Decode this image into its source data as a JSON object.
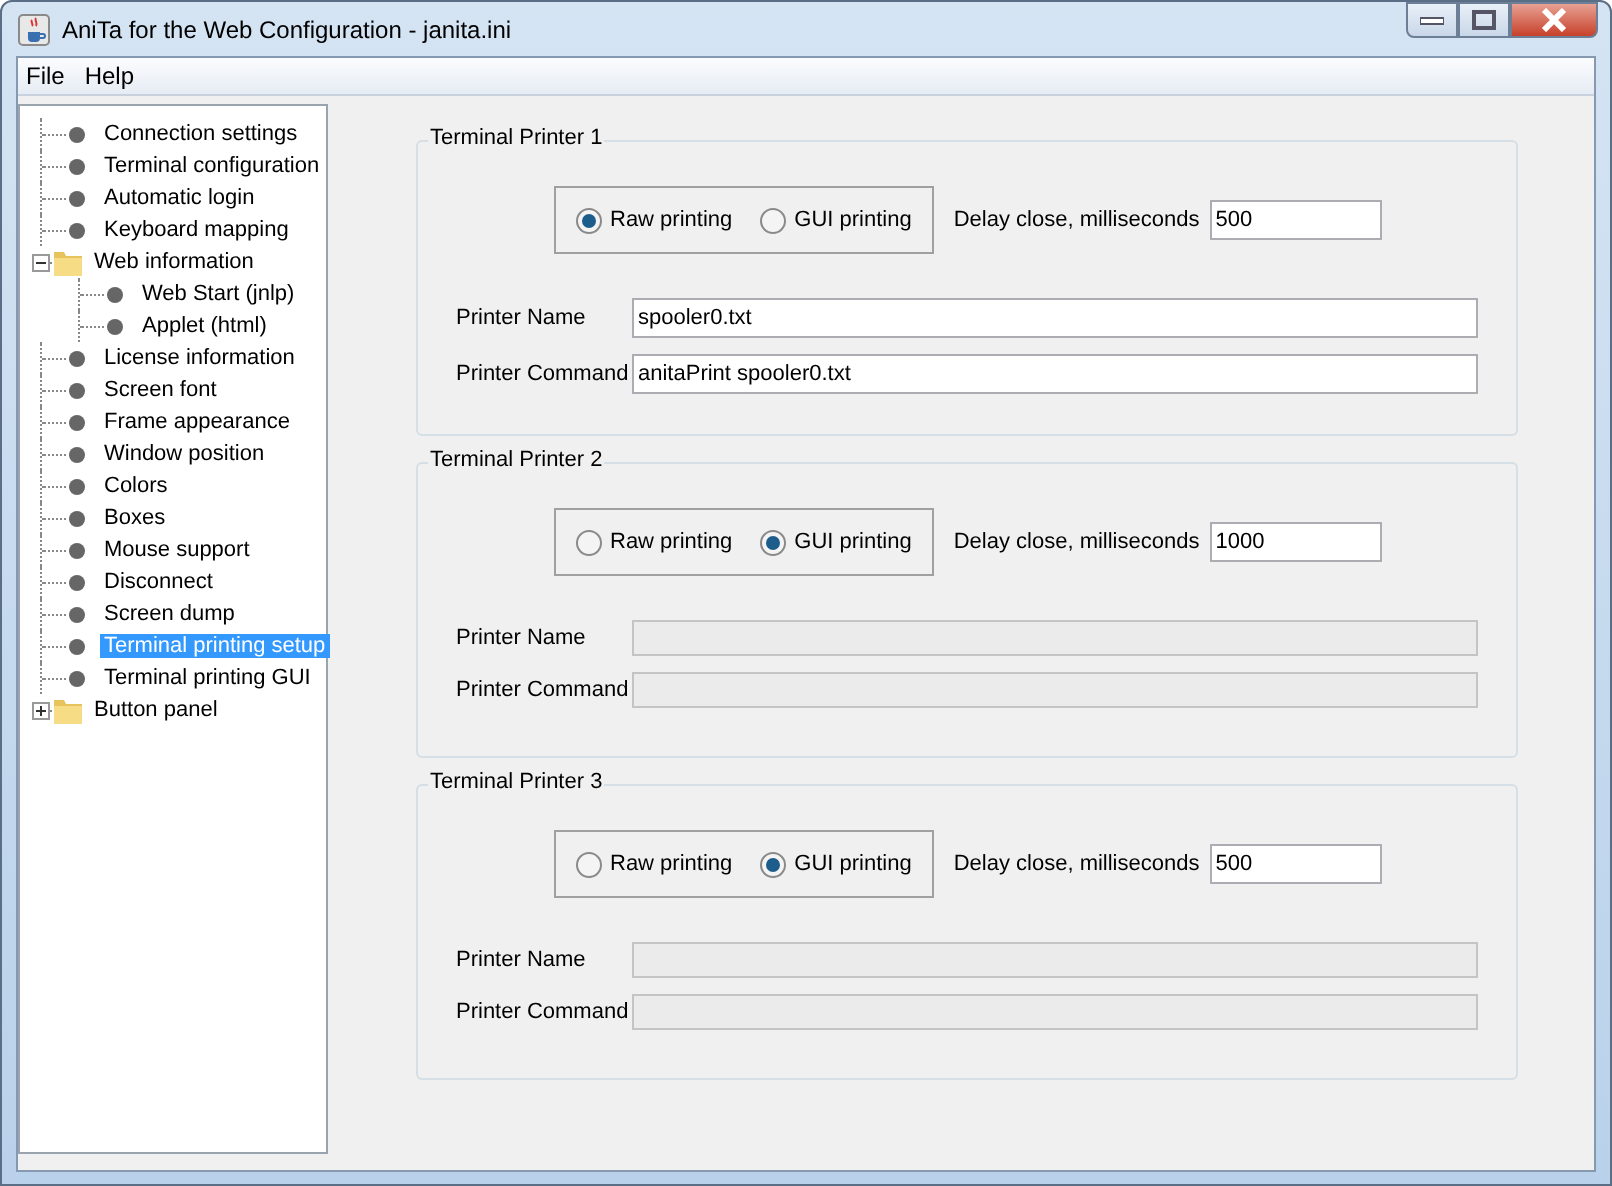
{
  "window": {
    "title": "AniTa for the Web Configuration - janita.ini"
  },
  "menu": [
    "File",
    "Help"
  ],
  "tree": [
    {
      "label": "Connection settings",
      "kind": "leaf",
      "selected": false
    },
    {
      "label": "Terminal configuration",
      "kind": "leaf",
      "selected": false
    },
    {
      "label": "Automatic login",
      "kind": "leaf",
      "selected": false
    },
    {
      "label": "Keyboard mapping",
      "kind": "leaf",
      "selected": false
    },
    {
      "label": "Web information",
      "kind": "folder",
      "selected": false,
      "expanded": true,
      "children": [
        {
          "label": "Web Start (jnlp)",
          "kind": "leaf",
          "selected": false
        },
        {
          "label": "Applet (html)",
          "kind": "leaf",
          "selected": false
        }
      ]
    },
    {
      "label": "License information",
      "kind": "leaf",
      "selected": false
    },
    {
      "label": "Screen font",
      "kind": "leaf",
      "selected": false
    },
    {
      "label": "Frame appearance",
      "kind": "leaf",
      "selected": false
    },
    {
      "label": "Window position",
      "kind": "leaf",
      "selected": false
    },
    {
      "label": "Colors",
      "kind": "leaf",
      "selected": false
    },
    {
      "label": "Boxes",
      "kind": "leaf",
      "selected": false
    },
    {
      "label": "Mouse support",
      "kind": "leaf",
      "selected": false
    },
    {
      "label": "Disconnect",
      "kind": "leaf",
      "selected": false
    },
    {
      "label": "Screen dump",
      "kind": "leaf",
      "selected": false
    },
    {
      "label": "Terminal printing setup",
      "kind": "leaf",
      "selected": true
    },
    {
      "label": "Terminal printing GUI",
      "kind": "leaf",
      "selected": false
    },
    {
      "label": "Button panel",
      "kind": "folder",
      "selected": false,
      "expanded": false
    }
  ],
  "printers": [
    {
      "title": "Terminal Printer 1",
      "modes": [
        {
          "label": "Raw printing",
          "selected": true
        },
        {
          "label": "GUI printing",
          "selected": false
        }
      ],
      "delay_label": "Delay close, milliseconds",
      "delay": "500",
      "name_label": "Printer Name",
      "name": {
        "value": "spooler0.txt",
        "disabled": false
      },
      "command_label": "Printer Command",
      "command": {
        "value": "anitaPrint spooler0.txt",
        "disabled": false
      }
    },
    {
      "title": "Terminal Printer 2",
      "modes": [
        {
          "label": "Raw printing",
          "selected": false
        },
        {
          "label": "GUI printing",
          "selected": true
        }
      ],
      "delay_label": "Delay close, milliseconds",
      "delay": "1000",
      "name_label": "Printer Name",
      "name": {
        "disabled": true
      },
      "command_label": "Printer Command",
      "command": {
        "disabled": true
      }
    },
    {
      "title": "Terminal Printer 3",
      "modes": [
        {
          "label": "Raw printing",
          "selected": false
        },
        {
          "label": "GUI printing",
          "selected": true
        }
      ],
      "delay_label": "Delay close, milliseconds",
      "delay": "500",
      "name_label": "Printer Name",
      "name": {
        "disabled": true
      },
      "command_label": "Printer Command",
      "command": {
        "disabled": true
      }
    }
  ]
}
